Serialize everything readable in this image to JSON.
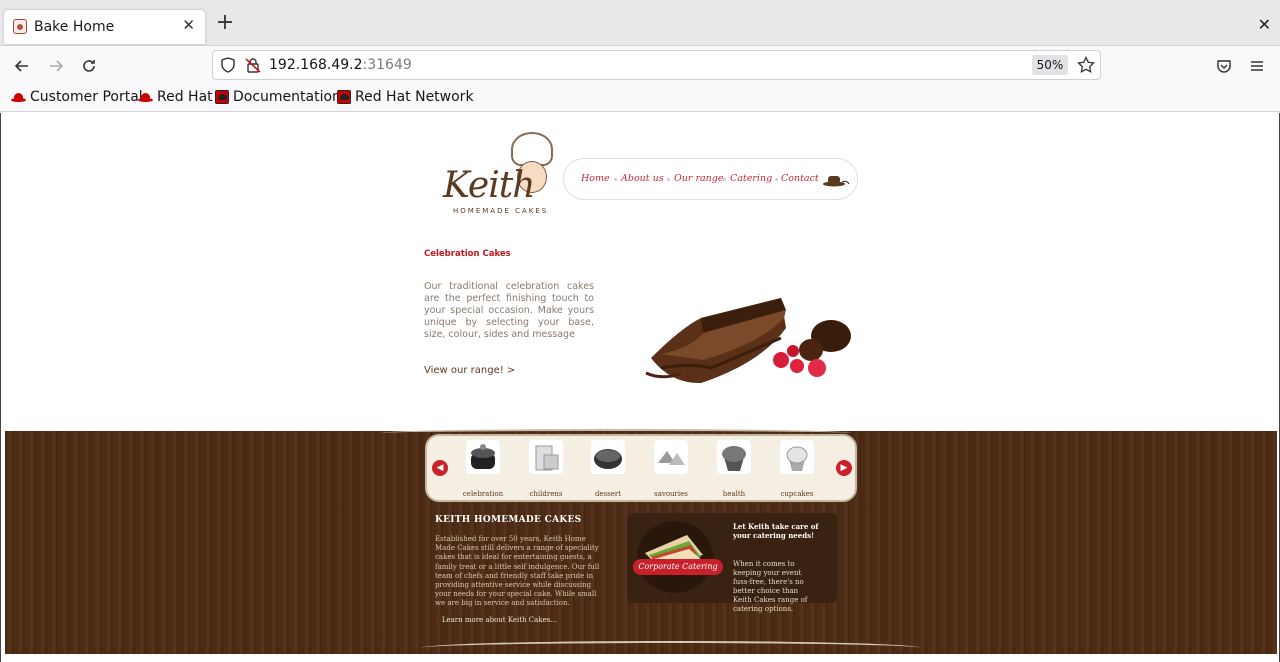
{
  "browser": {
    "tab_title": "Bake Home",
    "url_host": "192.168.49.2",
    "url_port": ":31649",
    "zoom": "50%",
    "bookmarks": [
      "Customer Portal",
      "Red Hat",
      "Documentation",
      "Red Hat Network"
    ]
  },
  "site": {
    "logo_text": "Keith",
    "logo_sub": "HOMEMADE CAKES",
    "menu": [
      "Home",
      "About us",
      "Our range",
      "Catering",
      "Contact"
    ],
    "hero": {
      "title": "Celebration Cakes",
      "description": "Our traditional celebration cakes are the perfect finishing touch to your special occasion. Make yours unique by selecting your base, size, colour, sides and message",
      "link": "View our range!   >"
    },
    "carousel": [
      "celebration",
      "childrens",
      "dessert",
      "savouries",
      "health",
      "cupcakes"
    ],
    "about": {
      "title": "KEITH HOMEMADE CAKES",
      "text": "Established for over 50 years, Keith Home Made Cakes still delivers a range of speciality cakes that is ideal for entertaining guests, a family treat or a little self indulgence. Our full team of chefs and friendly staff take pride in providing attentive service while discussing your needs for your special cake. While small we are big in service and satisfaction.",
      "link": "Learn more about Keith Cakes..."
    },
    "catering": {
      "ribbon": "Corporate Catering",
      "heading": "Let Keith take care of your catering needs!",
      "text": "When it comes to keeping your event fuss-free, there's no better choice than Keith Cakes range of catering options."
    }
  },
  "colors": {
    "accent_red": "#c4161c",
    "brown": "#5b3a22",
    "wood": "#4a2a15"
  }
}
